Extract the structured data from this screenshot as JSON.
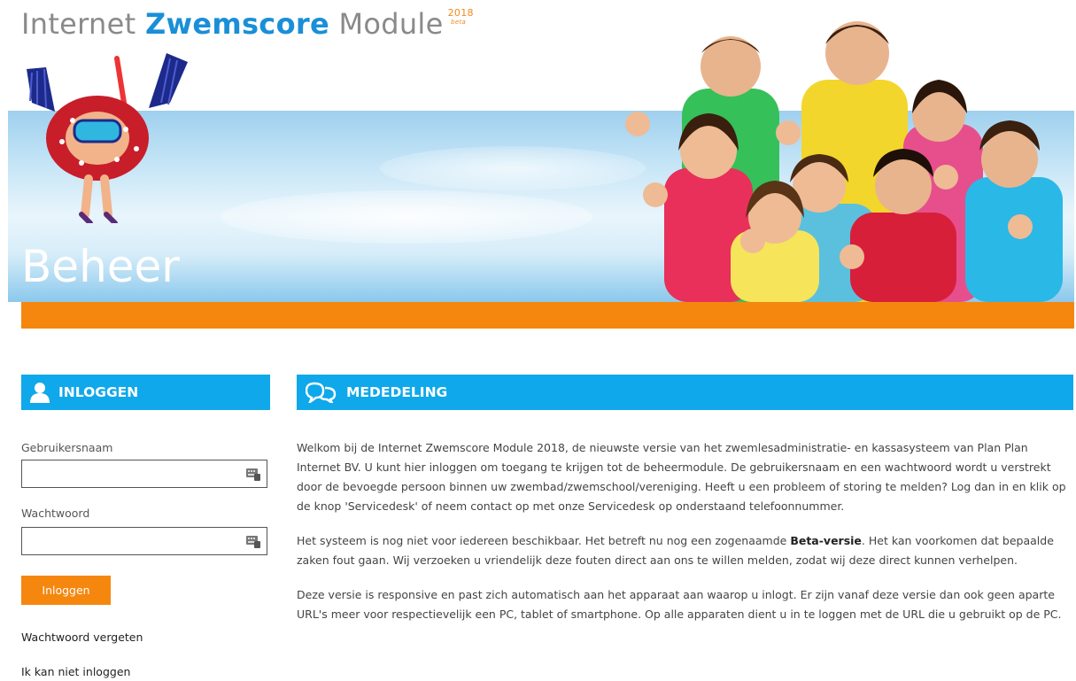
{
  "header": {
    "brand_part1": "Internet",
    "brand_part2": "Zwemscore",
    "brand_part3": "Module",
    "brand_year": "2018",
    "brand_tag": "beta",
    "section_title": "Beheer"
  },
  "login": {
    "title": "INLOGGEN",
    "username_label": "Gebruikersnaam",
    "username_value": "",
    "password_label": "Wachtwoord",
    "password_value": "",
    "submit_label": "Inloggen",
    "forgot_link": "Wachtwoord vergeten",
    "cannot_login_link": "Ik kan niet inloggen"
  },
  "news": {
    "title": "MEDEDELING",
    "p1": "Welkom bij de Internet Zwemscore Module 2018, de nieuwste versie van het zwemlesadministratie- en kassasysteem van Plan Plan Internet BV. U kunt hier inloggen om toegang te krijgen tot de beheermodule. De gebruikersnaam en een wachtwoord wordt u verstrekt door de bevoegde persoon binnen uw zwembad/zwemschool/vereniging. Heeft u een probleem of storing te melden? Log dan in en klik op de knop 'Servicedesk' of neem contact op met onze Servicedesk op onderstaand telefoonnummer.",
    "p2_before": "Het systeem is nog niet voor iedereen beschikbaar. Het betreft nu nog een zogenaamde ",
    "p2_bold": "Beta-versie",
    "p2_after": ". Het kan voorkomen dat bepaalde zaken fout gaan. Wij verzoeken u vriendelijk deze fouten direct aan ons te willen melden, zodat wij deze direct kunnen verhelpen.",
    "p3": "Deze versie is responsive en past zich automatisch aan het apparaat aan waarop u inlogt. Er zijn vanaf deze versie dan ook geen aparte URL's meer voor respectievelijk een PC, tablet of smartphone. Op alle apparaten dient u in te loggen met de URL die u gebruikt op de PC."
  },
  "icons": {
    "login_head": "user-icon",
    "news_head": "speech-bubbles-icon",
    "field_helper": "keyboard-icon"
  },
  "colors": {
    "accent_blue": "#0fa8ea",
    "accent_orange": "#f5870f",
    "brand_blue": "#1a8fd8"
  }
}
